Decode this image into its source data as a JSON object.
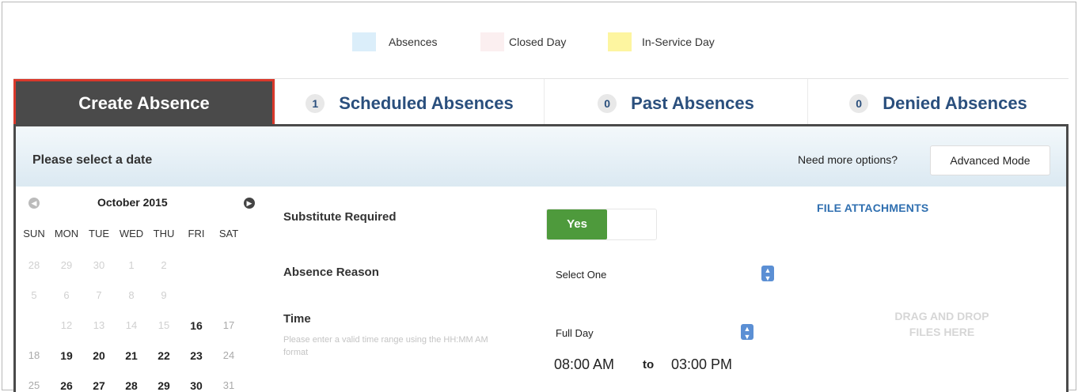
{
  "legend": {
    "items": [
      {
        "label": "Absences",
        "color": "#dbeefa"
      },
      {
        "label": "Closed Day",
        "color": "#fbeff0"
      },
      {
        "label": "In-Service Day",
        "color": "#fdf5a0"
      }
    ]
  },
  "tabs": [
    {
      "label": "Create Absence",
      "count": null,
      "active": true
    },
    {
      "label": "Scheduled Absences",
      "count": "1",
      "active": false
    },
    {
      "label": "Past Absences",
      "count": "0",
      "active": false
    },
    {
      "label": "Denied Absences",
      "count": "0",
      "active": false
    }
  ],
  "panel": {
    "title": "Please select a date",
    "more_options": "Need more options?",
    "advanced_button": "Advanced Mode"
  },
  "calendar": {
    "month": "October 2015",
    "weekdays": [
      "SUN",
      "MON",
      "TUE",
      "WED",
      "THU",
      "FRI",
      "SAT"
    ],
    "weeks": [
      [
        "28",
        "29",
        "30",
        "1",
        "2",
        "",
        ""
      ],
      [
        "5",
        "6",
        "7",
        "8",
        "9",
        "",
        ""
      ],
      [
        "",
        "12",
        "13",
        "14",
        "15",
        "16",
        "17"
      ],
      [
        "18",
        "19",
        "20",
        "21",
        "22",
        "23",
        "24"
      ],
      [
        "25",
        "26",
        "27",
        "28",
        "29",
        "30",
        "31"
      ]
    ]
  },
  "form": {
    "substitute_label": "Substitute Required",
    "substitute_value": "Yes",
    "reason_label": "Absence Reason",
    "reason_value": "Select One",
    "time_label": "Time",
    "time_hint": "Please enter a valid time range using the HH:MM AM format",
    "time_value": "Full Day",
    "start_time": "08:00 AM",
    "to_label": "to",
    "end_time": "03:00 PM"
  },
  "attachments": {
    "title": "FILE ATTACHMENTS",
    "drop_line1": "DRAG AND DROP",
    "drop_line2": "FILES HERE"
  }
}
